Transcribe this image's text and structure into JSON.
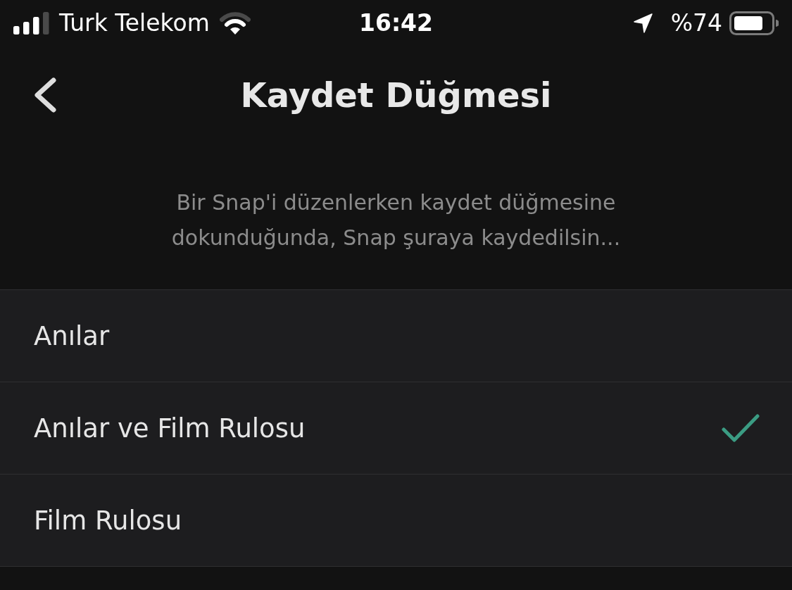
{
  "status_bar": {
    "carrier": "Turk Telekom",
    "time": "16:42",
    "battery": "%74"
  },
  "nav_bar": {
    "title": "Kaydet Düğmesi"
  },
  "description": "Bir Snap'i düzenlerken kaydet düğmesine dokunduğunda, Snap şuraya kaydedilsin...",
  "options": [
    {
      "label": "Anılar",
      "selected": false
    },
    {
      "label": "Anılar ve Film Rulosu",
      "selected": true
    },
    {
      "label": "Film Rulosu",
      "selected": false
    }
  ]
}
